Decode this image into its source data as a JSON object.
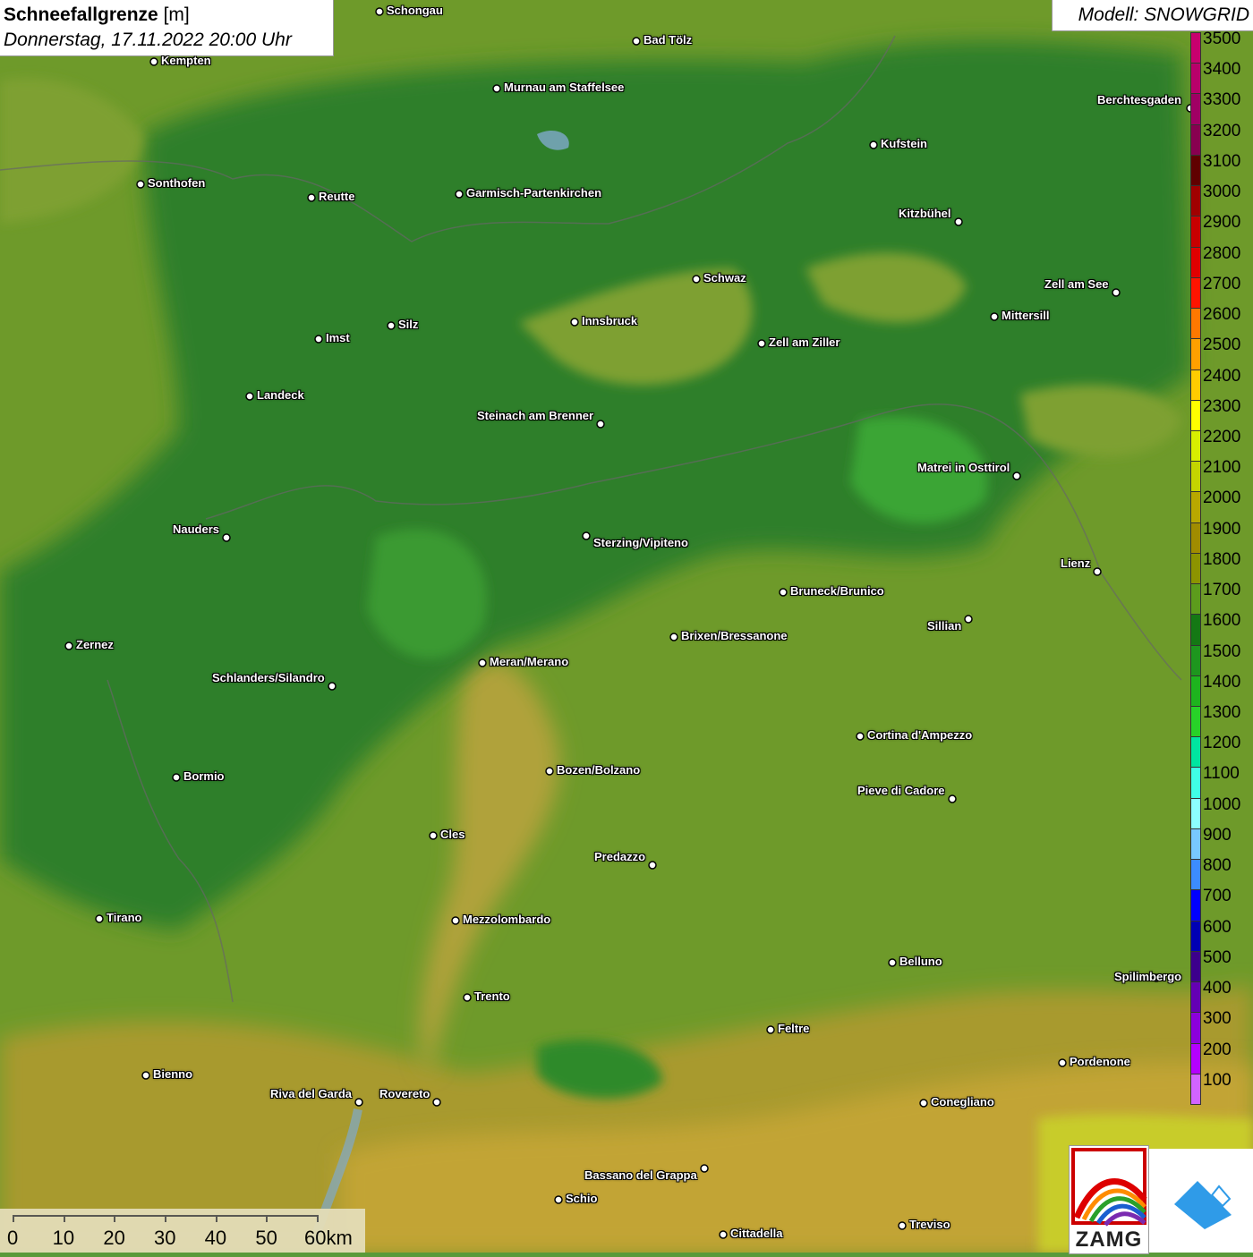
{
  "title": {
    "main": "Schneefallgrenze",
    "unit": "[m]",
    "datetime": "Donnerstag, 17.11.2022 20:00 Uhr"
  },
  "model": "Modell: SNOWGRID",
  "cities": [
    {
      "name": "Schongau"
    },
    {
      "name": "Bad Tölz"
    },
    {
      "name": "Kempten"
    },
    {
      "name": "Murnau am Staffelsee"
    },
    {
      "name": "Berchtesgaden"
    },
    {
      "name": "Kufstein"
    },
    {
      "name": "Sonthofen"
    },
    {
      "name": "Reutte"
    },
    {
      "name": "Garmisch-Partenkirchen"
    },
    {
      "name": "Kitzbühel"
    },
    {
      "name": "Schwaz"
    },
    {
      "name": "Zell am See"
    },
    {
      "name": "Silz"
    },
    {
      "name": "Innsbruck"
    },
    {
      "name": "Imst"
    },
    {
      "name": "Zell am Ziller"
    },
    {
      "name": "Mittersill"
    },
    {
      "name": "Landeck"
    },
    {
      "name": "Steinach am Brenner"
    },
    {
      "name": "Matrei in Osttirol"
    },
    {
      "name": "Nauders"
    },
    {
      "name": "Sterzing/Vipiteno"
    },
    {
      "name": "Lienz"
    },
    {
      "name": "Bruneck/Brunico"
    },
    {
      "name": "Sillian"
    },
    {
      "name": "Brixen/Bressanone"
    },
    {
      "name": "Zernez"
    },
    {
      "name": "Meran/Merano"
    },
    {
      "name": "Schlanders/Silandro"
    },
    {
      "name": "Cortina d'Ampezzo"
    },
    {
      "name": "Bozen/Bolzano"
    },
    {
      "name": "Bormio"
    },
    {
      "name": "Pieve di Cadore"
    },
    {
      "name": "Cles"
    },
    {
      "name": "Predazzo"
    },
    {
      "name": "Tirano"
    },
    {
      "name": "Mezzolombardo"
    },
    {
      "name": "Belluno"
    },
    {
      "name": "Spilimbergo"
    },
    {
      "name": "Trento"
    },
    {
      "name": "Feltre"
    },
    {
      "name": "Pordenone"
    },
    {
      "name": "Bienno"
    },
    {
      "name": "Riva del Garda"
    },
    {
      "name": "Rovereto"
    },
    {
      "name": "Conegliano"
    },
    {
      "name": "Bassano del Grappa"
    },
    {
      "name": "Schio"
    },
    {
      "name": "Treviso"
    },
    {
      "name": "Cittadella"
    }
  ],
  "legend": {
    "labels": [
      "3500",
      "3400",
      "3300",
      "3200",
      "3100",
      "3000",
      "2900",
      "2800",
      "2700",
      "2600",
      "2500",
      "2400",
      "2300",
      "2200",
      "2100",
      "2000",
      "1900",
      "1800",
      "1700",
      "1600",
      "1500",
      "1400",
      "1300",
      "1200",
      "1100",
      "1000",
      "900",
      "800",
      "700",
      "600",
      "500",
      "400",
      "300",
      "200",
      "100"
    ],
    "colors": [
      "#c8006e",
      "#b8006a",
      "#a00064",
      "#880050",
      "#600000",
      "#a00000",
      "#c80000",
      "#e00000",
      "#ff1400",
      "#ff7800",
      "#ffa000",
      "#ffcc00",
      "#ffff00",
      "#d8ee00",
      "#c4d400",
      "#b8a800",
      "#a08c00",
      "#8c9400",
      "#5c9c1c",
      "#147814",
      "#1e961e",
      "#1eb41e",
      "#28d228",
      "#00e6a0",
      "#40ffe6",
      "#8cffff",
      "#78c8ff",
      "#3c8cff",
      "#0000ff",
      "#0000b4",
      "#3c008c",
      "#6400b4",
      "#8c00dc",
      "#b400ff",
      "#d264ff"
    ]
  },
  "scale": {
    "labels": [
      "0",
      "10",
      "20",
      "30",
      "40",
      "50",
      "60km"
    ]
  },
  "logos": {
    "zamg": "ZAMG"
  }
}
